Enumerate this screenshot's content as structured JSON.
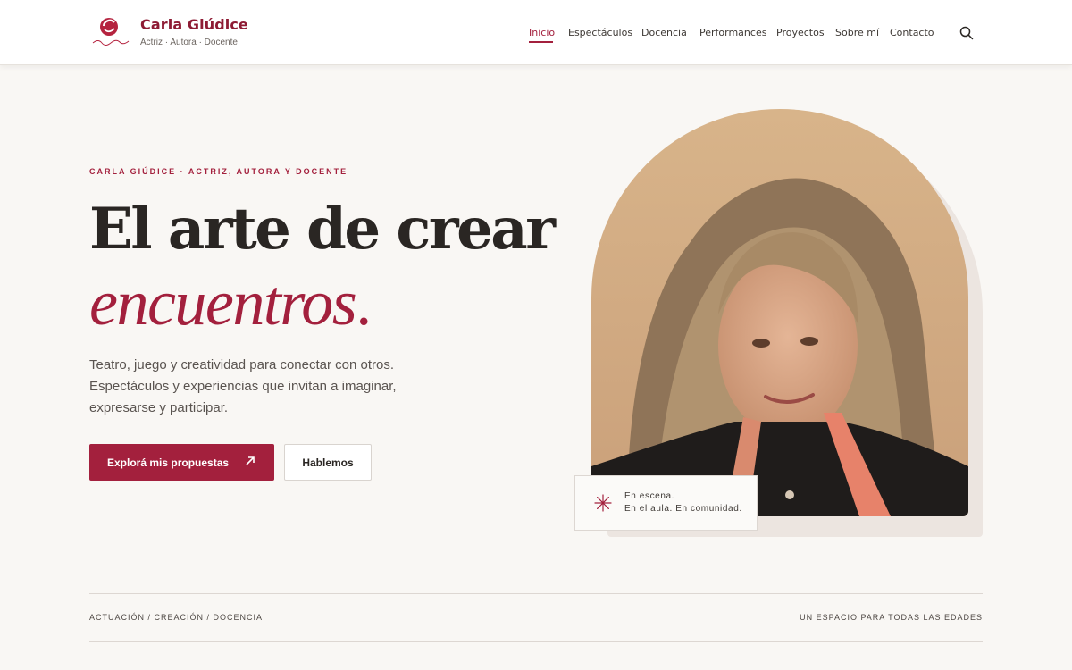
{
  "site": {
    "brand_name": "Carla Giúdice",
    "brand_tagline": "Actriz · Autora · Docente",
    "logo_icon": "carla-giudice-logo"
  },
  "nav": {
    "items": [
      {
        "label": "Inicio",
        "active": true
      },
      {
        "label": "Espectáculos",
        "active": false
      },
      {
        "label": "Docencia",
        "active": false
      },
      {
        "label": "Performances",
        "active": false
      },
      {
        "label": "Proyectos",
        "active": false
      },
      {
        "label": "Sobre mí",
        "active": false
      },
      {
        "label": "Contacto",
        "active": false
      }
    ],
    "search_icon": "search-icon"
  },
  "hero": {
    "eyebrow": "CARLA GIÚDICE · ACTRIZ, AUTORA Y DOCENTE",
    "headline": "El arte de crear",
    "headline_em": "encuentros",
    "headline_period": ".",
    "lede": "Teatro, juego y creatividad para conectar con otros. Espectáculos y experiencias que invitan a imaginar, expresarse y participar.",
    "cta_primary": "Explorá mis propuestas",
    "cta_primary_icon": "arrow-up-right-icon",
    "cta_secondary": "Hablemos"
  },
  "portrait": {
    "caption_line1": "En escena.",
    "caption_line2": "En el aula. En comunidad.",
    "caption_icon": "asterisk-icon"
  },
  "strip": {
    "left": "ACTUACIÓN / CREACIÓN / DOCENCIA",
    "right": "UN ESPACIO PARA TODAS LAS EDADES"
  },
  "colors": {
    "accent": "#a3203d",
    "background": "#f9f7f4",
    "text": "#2a2623"
  }
}
